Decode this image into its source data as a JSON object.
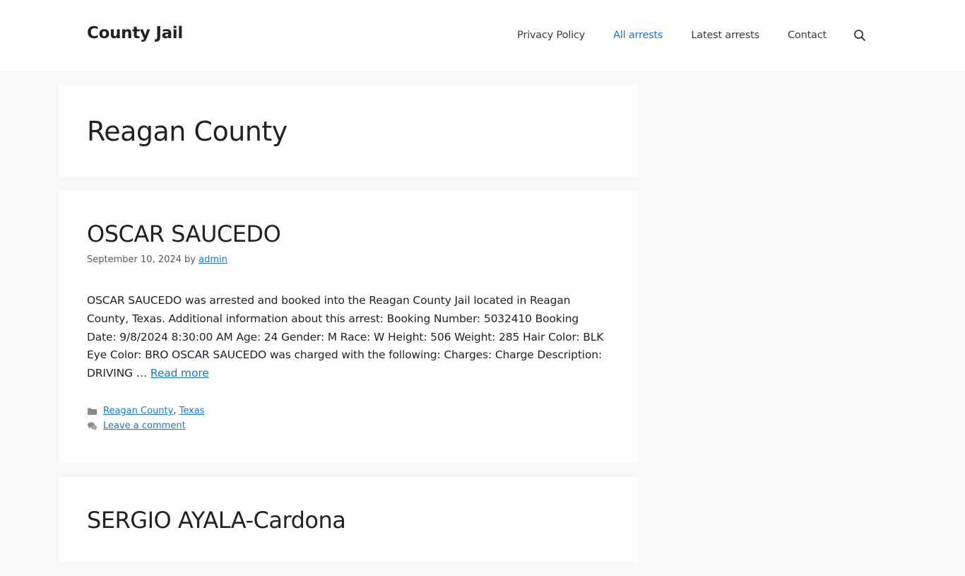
{
  "header": {
    "site_title": "County Jail",
    "nav": [
      {
        "label": "Privacy Policy",
        "active": false
      },
      {
        "label": "All arrests",
        "active": true
      },
      {
        "label": "Latest arrests",
        "active": false
      },
      {
        "label": "Contact",
        "active": false
      }
    ],
    "search_icon": "search-icon"
  },
  "page": {
    "title": "Reagan County"
  },
  "posts": [
    {
      "title": "OSCAR SAUCEDO",
      "date": "September 10, 2024",
      "by": "by",
      "author": "admin",
      "summary": "OSCAR SAUCEDO was arrested and booked into the Reagan County Jail located in Reagan County, Texas. Additional information about this arrest: Booking Number: 5032410 Booking Date: 9/8/2024 8:30:00 AM Age: 24 Gender: M Race: W Height: 506 Weight: 285 Hair Color: BLK Eye Color: BRO OSCAR SAUCEDO was charged with the following: Charges: Charge Description: DRIVING …",
      "read_more": "Read more",
      "categories": [
        "Reagan County",
        "Texas"
      ],
      "category_sep": ",",
      "comment_link": "Leave a comment",
      "folder_icon": "folder-icon",
      "comments_icon": "comments-icon"
    },
    {
      "title": "SERGIO AYALA-Cardona"
    }
  ]
}
